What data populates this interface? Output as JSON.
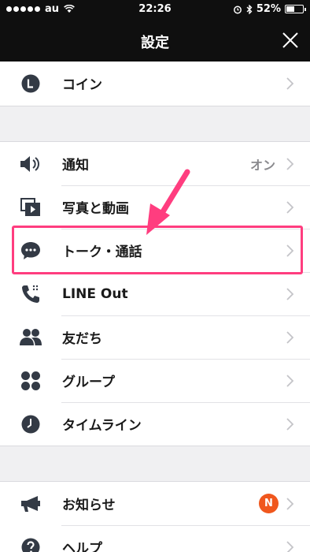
{
  "status": {
    "carrier": "au",
    "time": "22:26",
    "battery": "52%",
    "battery_level": 0.52
  },
  "header": {
    "title": "設定"
  },
  "items": [
    {
      "label": "コイン",
      "icon": "coin-icon"
    },
    {
      "label": "通知",
      "value": "オン",
      "icon": "speaker-icon"
    },
    {
      "label": "写真と動画",
      "icon": "photo-video-icon"
    },
    {
      "label": "トーク・通話",
      "icon": "chat-bubble-icon"
    },
    {
      "label": "LINE Out",
      "icon": "phone-icon"
    },
    {
      "label": "友だち",
      "icon": "friends-icon"
    },
    {
      "label": "グループ",
      "icon": "group-icon"
    },
    {
      "label": "タイムライン",
      "icon": "clock-icon"
    },
    {
      "label": "お知らせ",
      "badge": "N",
      "icon": "megaphone-icon"
    },
    {
      "label": "ヘルプ",
      "icon": "help-icon"
    }
  ],
  "colors": {
    "highlight": "#ff3d7f",
    "badge": "#f0571d",
    "header_bg": "#0f0f0f"
  }
}
